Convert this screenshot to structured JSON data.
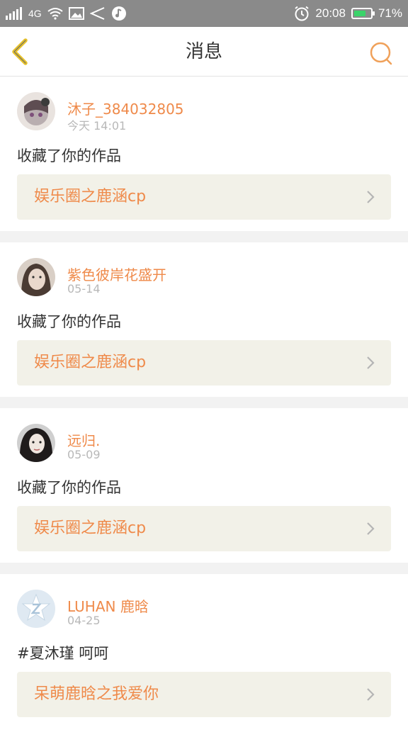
{
  "status_bar": {
    "network": "4G",
    "time": "20:08",
    "battery": "71%",
    "battery_level": 0.71
  },
  "header": {
    "title": "消息"
  },
  "messages": [
    {
      "name": "沐子_384032805",
      "time": "今天 14:01",
      "action": "收藏了你的作品",
      "work": "娱乐圈之鹿涵cp"
    },
    {
      "name": "紫色彼岸花盛开",
      "time": "05-14",
      "action": "收藏了你的作品",
      "work": "娱乐圈之鹿涵cp"
    },
    {
      "name": "远归.",
      "time": "05-09",
      "action": "收藏了你的作品",
      "work": "娱乐圈之鹿涵cp"
    },
    {
      "name": "LUHAN 鹿晗",
      "time": "04-25",
      "action": "#夏沐瑾 呵呵",
      "work": "呆萌鹿晗之我爱你"
    }
  ],
  "colors": {
    "accent": "#ef8a4a",
    "link_bg": "#f2f1e8",
    "back_icon": "#e6c12a"
  },
  "icons": [
    "signal-icon",
    "wifi-icon",
    "image-icon",
    "share-icon",
    "music-icon",
    "alarm-icon",
    "battery-icon",
    "back-arrow-icon",
    "search-icon",
    "chevron-right-icon"
  ]
}
